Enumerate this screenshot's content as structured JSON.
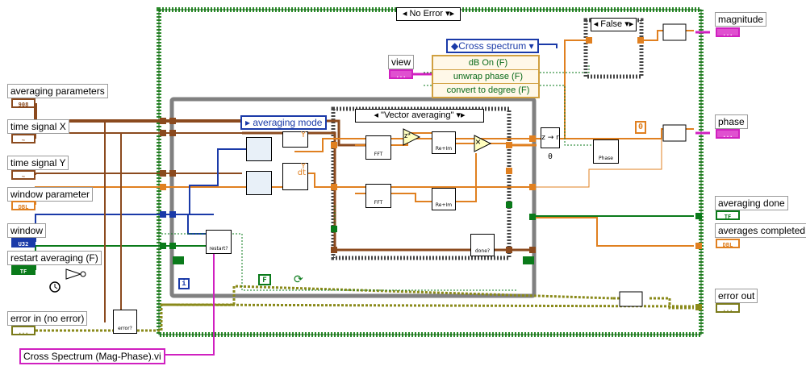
{
  "case_structure": {
    "selector": "No Error"
  },
  "false_case": {
    "selector": "False"
  },
  "inner_case": {
    "selector": "\"Vector averaging\""
  },
  "enum_constant": {
    "value": "Cross spectrum"
  },
  "averaging_mode": {
    "label": "averaging mode"
  },
  "cluster_items": [
    "dB On (F)",
    "unwrap phase (F)",
    "convert to degree (F)"
  ],
  "controls": {
    "averaging_parameters": {
      "label": "averaging parameters",
      "type": "908"
    },
    "time_signal_x": {
      "label": "time signal X",
      "type": "~"
    },
    "time_signal_y": {
      "label": "time signal Y",
      "type": "~"
    },
    "window_parameter": {
      "label": "window parameter",
      "type": "DBL"
    },
    "window": {
      "label": "window",
      "type": "U32"
    },
    "restart_averaging": {
      "label": "restart averaging (F)",
      "type": "TF"
    },
    "error_in": {
      "label": "error in (no error)",
      "type": "..."
    },
    "view": {
      "label": "view",
      "type": "..."
    }
  },
  "indicators": {
    "magnitude": {
      "label": "magnitude",
      "type": "..."
    },
    "phase": {
      "label": "phase",
      "type": "..."
    },
    "averaging_done": {
      "label": "averaging done",
      "type": "TF"
    },
    "averages_completed": {
      "label": "averages completed",
      "type": "DBL"
    },
    "error_out": {
      "label": "error out",
      "type": "..."
    }
  },
  "vi_name": "Cross Spectrum (Mag-Phase).vi",
  "nodes": {
    "fft": "FFT",
    "re_im": "Re+Im",
    "restart": "restart?",
    "done": "done?",
    "error": "error?",
    "phase": "Phase",
    "y": "Y",
    "dt": "dt",
    "zero": "0",
    "iteration": "i",
    "false_const": "F",
    "multiply": "×",
    "conjugate": "z*",
    "polar": "z → r θ"
  },
  "colors": {
    "loop_border": "#808080",
    "case_border": "#2a8a2a",
    "cluster_wire": "#8b4a1e",
    "waveform_wire": "#8b4a1e",
    "numeric_wire": "#e08020",
    "integer_wire": "#1a3aa8",
    "boolean_wire": "#0a7a1a",
    "error_wire": "#8a8a1a",
    "path_wire": "#d020c0"
  }
}
